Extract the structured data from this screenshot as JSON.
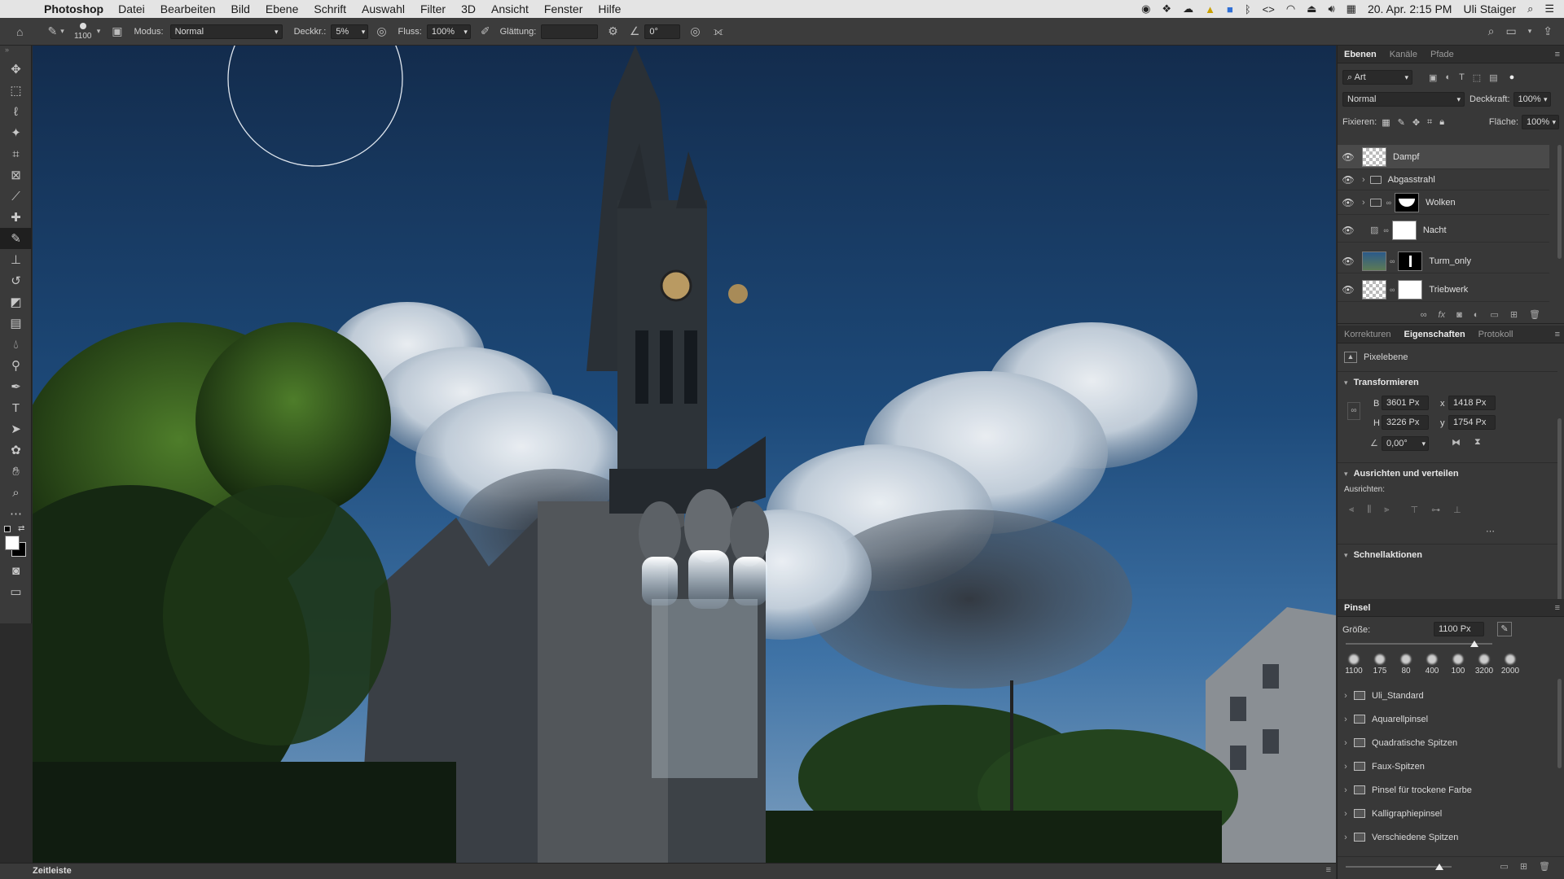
{
  "menubar": {
    "app": "Photoshop",
    "items": [
      "Datei",
      "Bearbeiten",
      "Bild",
      "Ebene",
      "Schrift",
      "Auswahl",
      "Filter",
      "3D",
      "Ansicht",
      "Fenster",
      "Hilfe"
    ],
    "datetime": "20. Apr. 2:15 PM",
    "user": "Uli Staiger"
  },
  "options": {
    "brush_size": "1100",
    "mode_label": "Modus:",
    "mode_value": "Normal",
    "opacity_label": "Deckkr.:",
    "opacity_value": "5%",
    "flow_label": "Fluss:",
    "flow_value": "100%",
    "smoothing_label": "Glättung:",
    "smoothing_value": "",
    "angle_value": "0°"
  },
  "layers_panel": {
    "tabs": [
      "Ebenen",
      "Kanäle",
      "Pfade"
    ],
    "filter_kind": "Art",
    "blend_mode": "Normal",
    "opacity_label": "Deckkraft:",
    "opacity_value": "100%",
    "lock_label": "Fixieren:",
    "fill_label": "Fläche:",
    "fill_value": "100%",
    "layers": [
      {
        "name": "Dampf",
        "selected": true
      },
      {
        "name": "Abgasstrahl",
        "selected": false
      },
      {
        "name": "Wolken",
        "selected": false
      },
      {
        "name": "Nacht",
        "selected": false
      },
      {
        "name": "Turm_only",
        "selected": false
      },
      {
        "name": "Triebwerk",
        "selected": false
      }
    ]
  },
  "properties_panel": {
    "tabs": [
      "Korrekturen",
      "Eigenschaften",
      "Protokoll"
    ],
    "kind": "Pixelebene",
    "transform_title": "Transformieren",
    "w_label": "B",
    "w_value": "3601 Px",
    "x_label": "x",
    "x_value": "1418 Px",
    "h_label": "H",
    "h_value": "3226 Px",
    "y_label": "y",
    "y_value": "1754 Px",
    "angle_value": "0,00°",
    "align_title": "Ausrichten und verteilen",
    "align_label": "Ausrichten:",
    "quick_title": "Schnellaktionen"
  },
  "brush_panel": {
    "title": "Pinsel",
    "size_label": "Größe:",
    "size_value": "1100 Px",
    "size_fraction": 0.88,
    "presets": [
      "1100",
      "175",
      "80",
      "400",
      "100",
      "3200",
      "2000"
    ],
    "folders": [
      "Uli_Standard",
      "Aquarellpinsel",
      "Quadratische Spitzen",
      "Faux-Spitzen",
      "Pinsel für trockene Farbe",
      "Kalligraphiepinsel",
      "Verschiedene Spitzen"
    ]
  },
  "statusbar": {
    "timeline_label": "Zeitleiste"
  }
}
